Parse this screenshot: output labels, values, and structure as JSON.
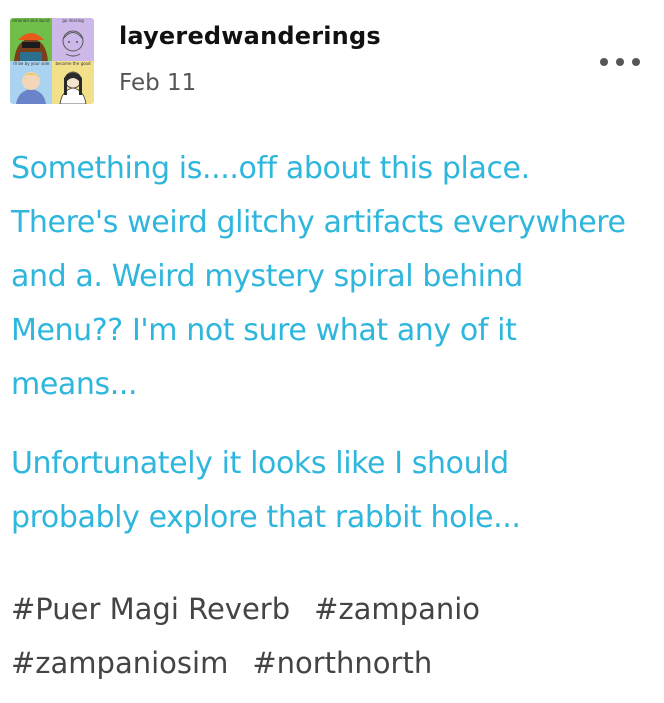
{
  "post": {
    "username": "layeredwanderings",
    "date": "Feb 11",
    "more_icon": "ellipsis-icon",
    "avatar": {
      "tiles": [
        {
          "caption": "emerald skin burst",
          "color": "#6fbf4a"
        },
        {
          "caption": "go missing",
          "color": "#cdb8ea"
        },
        {
          "caption": "i'll be by your side",
          "color": "#a9d3f0"
        },
        {
          "caption": "become the good",
          "color": "#f2e08a"
        }
      ]
    },
    "paragraphs": [
      "Something is....off about this place. There's weird glitchy artifacts everywhere and a. Weird mystery spiral behind Menu?? I'm not sure what any of it means...",
      "Unfortunately it looks like I should probably explore that rabbit hole..."
    ],
    "tags": [
      "#Puer Magi Reverb",
      "#zampanio",
      "#zampaniosim",
      "#northnorth"
    ]
  },
  "colors": {
    "body_text": "#2fb6dd",
    "tag_text": "#444444",
    "username": "#111111",
    "date": "#555555"
  }
}
